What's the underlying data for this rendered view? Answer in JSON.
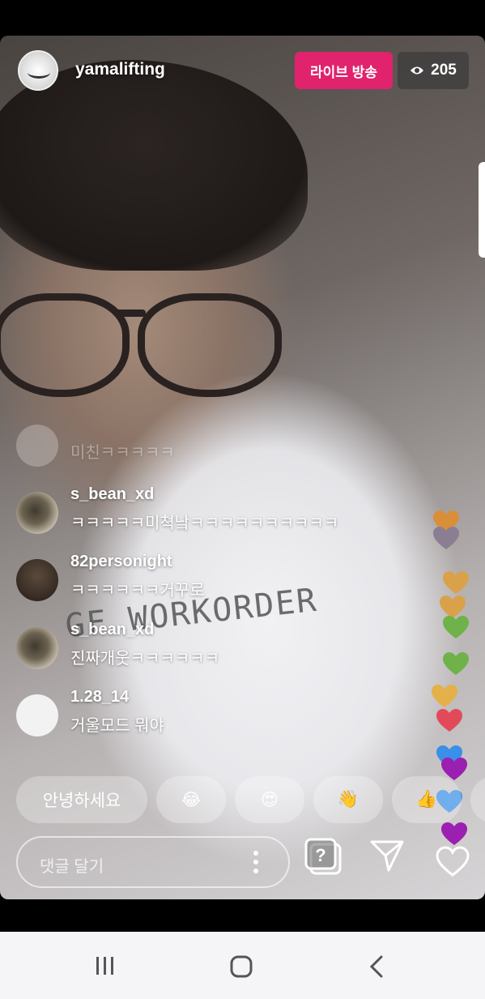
{
  "header": {
    "host_name": "yamalifting",
    "live_label": "라이브 방송",
    "viewer_count": "205"
  },
  "video": {
    "cloth_text": "GF WORKORDER"
  },
  "comments": [
    {
      "user": "",
      "text": "미친ㅋㅋㅋㅋㅋ"
    },
    {
      "user": "s_bean_xd",
      "text": "ㅋㅋㅋㅋㅋ미쳑낰ㅋㅋㅋㅋㅋㅋㅋㅋㅋㅋ"
    },
    {
      "user": "82personight",
      "text": "ㅋㅋㅋㅋㅋㅋ거꾸로"
    },
    {
      "user": "s_bean_xd",
      "text": "진짜개웃ㅋㅋㅋㅋㅋㅋ"
    },
    {
      "user": "1.28_14",
      "text": "거울모드 뭐야"
    }
  ],
  "quick_replies": [
    "안녕하세요",
    "😂",
    "😍",
    "👋",
    "👍"
  ],
  "composer": {
    "placeholder": "댓글 달기"
  },
  "heart_colors": [
    "#d98e3a",
    "#8a7f92",
    "#d9a24a",
    "#d9a24a",
    "#6fb24a",
    "#6fb24a",
    "#e3b04a",
    "#e24a5a",
    "#3a8fe8",
    "#9b1fb0",
    "#3a8fe8",
    "#9b1fb0"
  ],
  "colors": {
    "live_badge": "#e1226d"
  }
}
